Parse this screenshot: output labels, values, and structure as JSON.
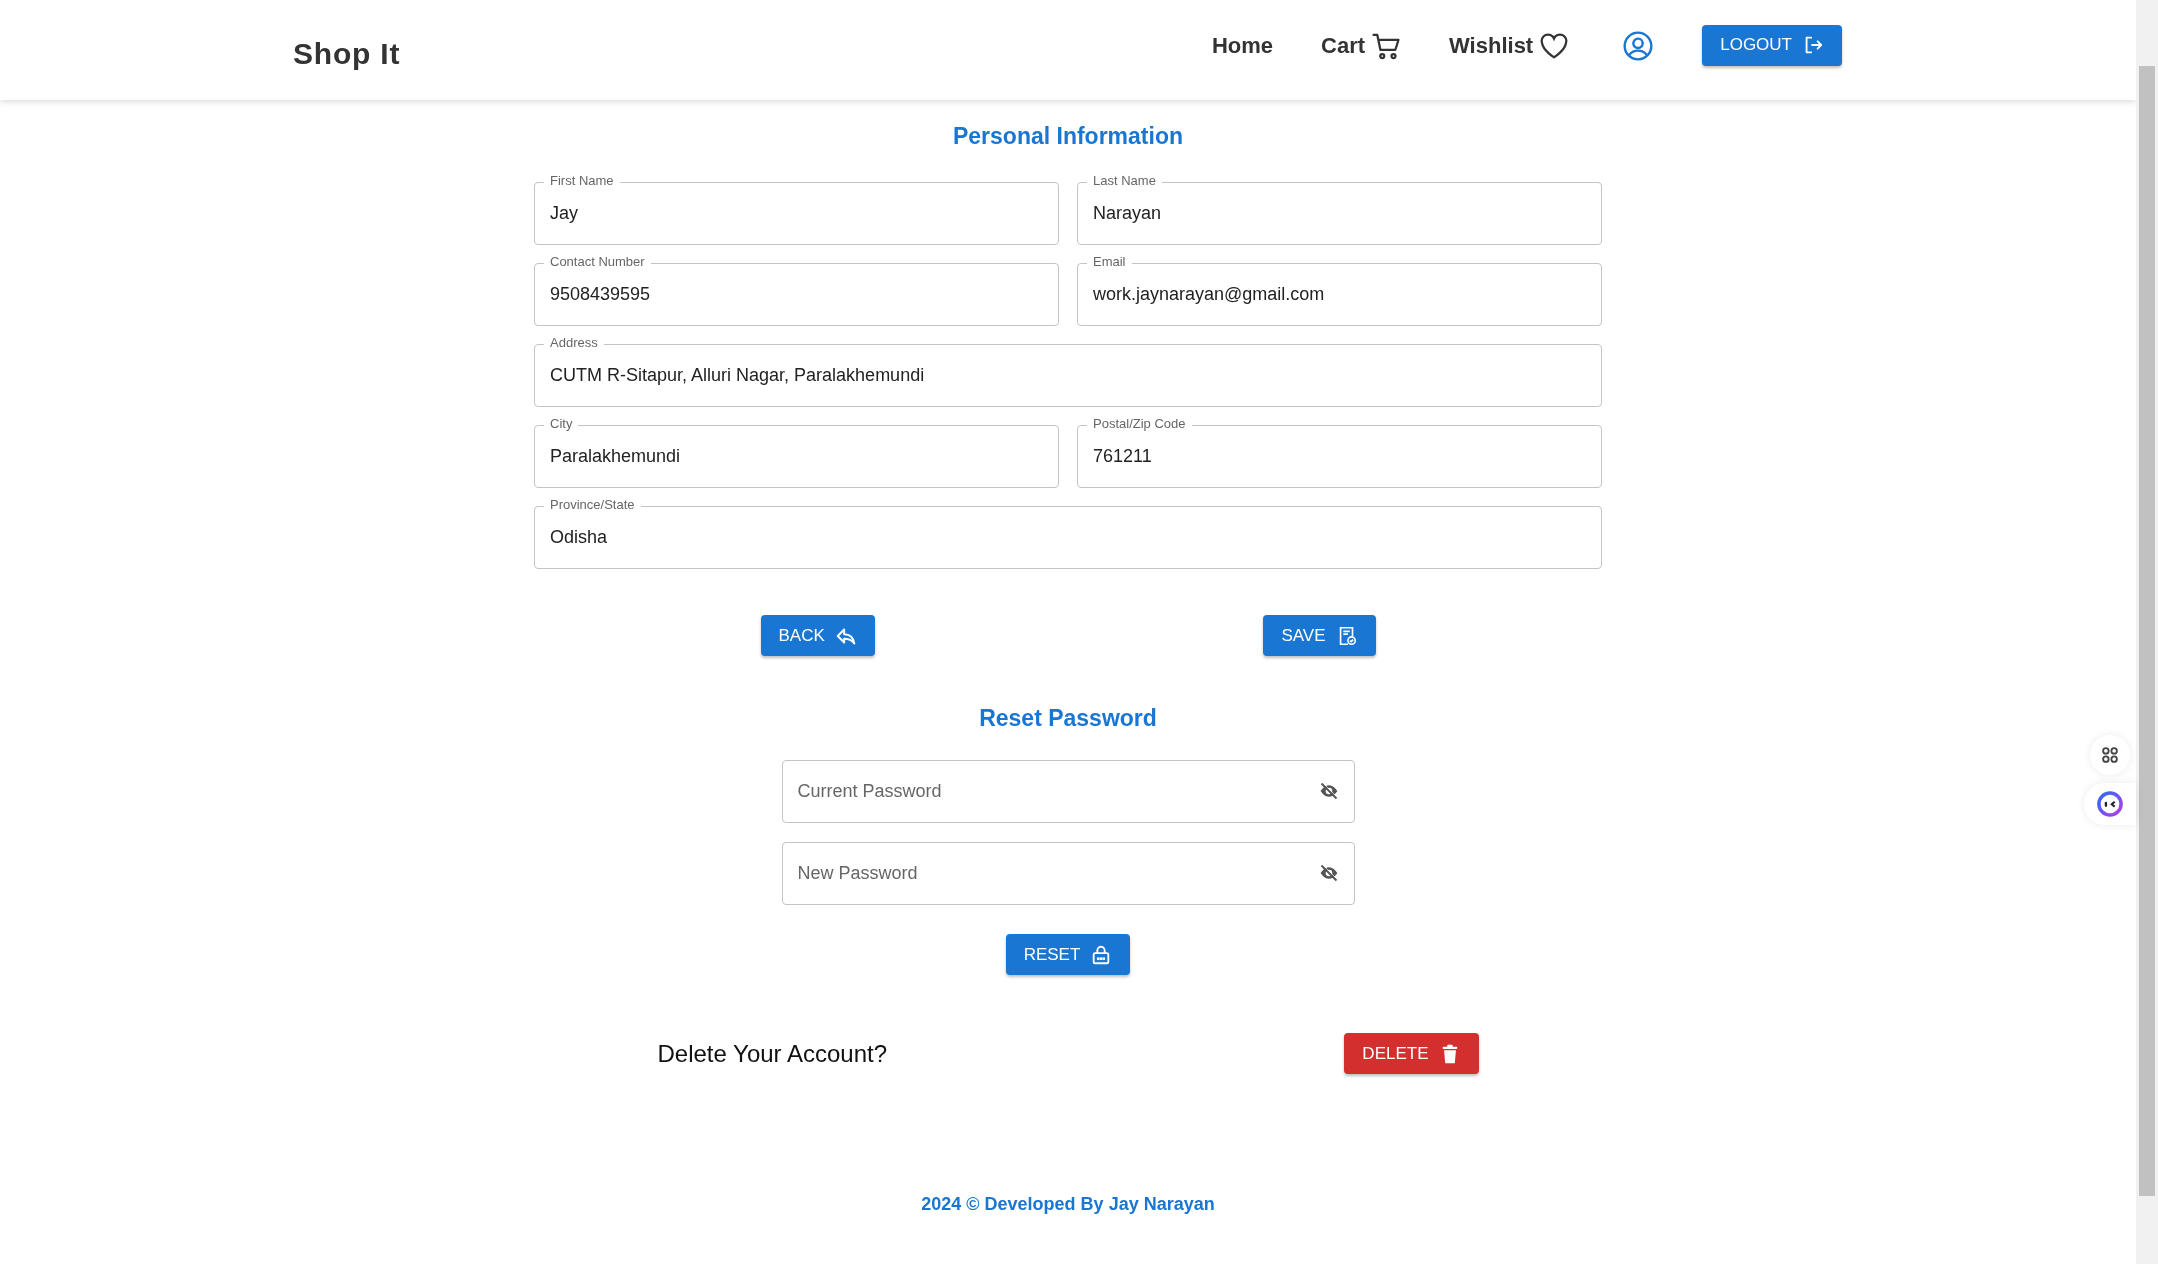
{
  "header": {
    "logo": "Shop It",
    "nav": [
      {
        "label": "Home",
        "kind": "text"
      },
      {
        "label": "Cart",
        "kind": "cart"
      },
      {
        "label": "Wishlist",
        "kind": "wishlist"
      }
    ],
    "logout": "LOGOUT"
  },
  "personal_information": {
    "title": "Personal Information",
    "rows": [
      [
        {
          "label": "First Name",
          "value": "Jay"
        },
        {
          "label": "Last Name",
          "value": "Narayan"
        }
      ],
      [
        {
          "label": "Contact Number",
          "value": "9508439595"
        },
        {
          "label": "Email",
          "value": "work.jaynarayan@gmail.com"
        }
      ],
      [
        {
          "label": "Address",
          "value": "CUTM R-Sitapur, Alluri Nagar, Paralakhemundi"
        }
      ],
      [
        {
          "label": "City",
          "value": "Paralakhemundi"
        },
        {
          "label": "Postal/Zip Code",
          "value": "761211"
        }
      ],
      [
        {
          "label": "Province/State",
          "value": "Odisha"
        }
      ]
    ],
    "buttons": [
      {
        "label": "BACK",
        "kind": "back"
      },
      {
        "label": "SAVE",
        "kind": "save"
      }
    ]
  },
  "reset_password": {
    "title": "Reset Password",
    "fields": [
      {
        "placeholder": "Current Password"
      },
      {
        "placeholder": "New Password"
      }
    ],
    "button": "RESET"
  },
  "delete_account": {
    "prompt": "Delete Your Account?",
    "button": "DELETE"
  },
  "footer": "2024 © Developed By Jay Narayan"
}
